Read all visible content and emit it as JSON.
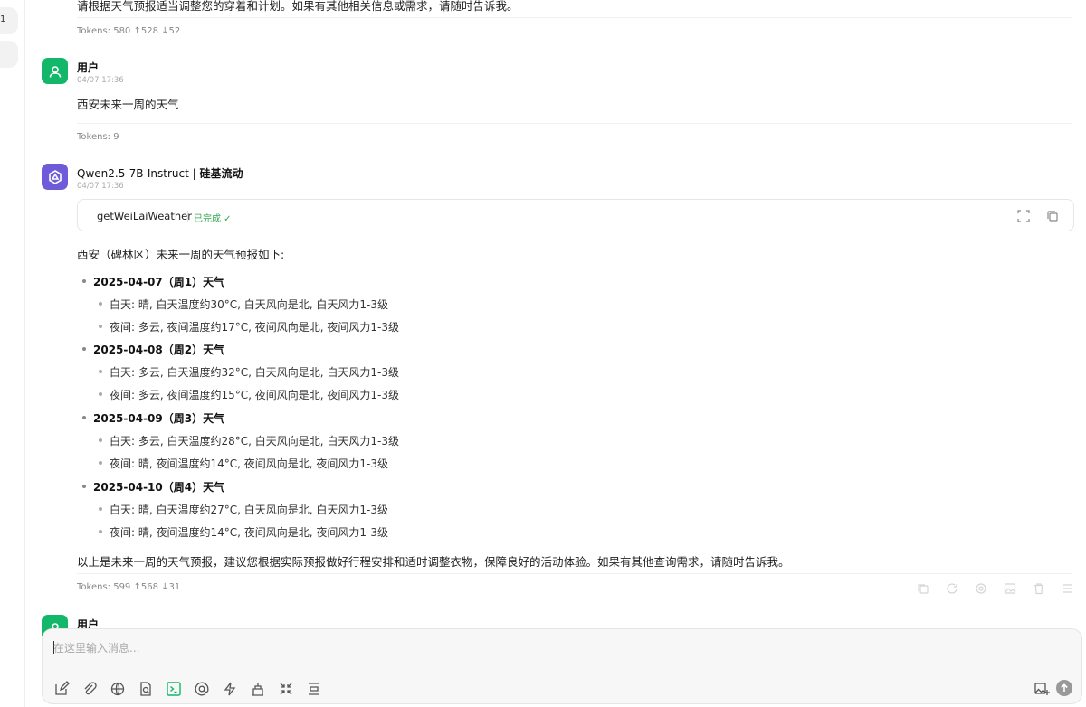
{
  "rail": {
    "item1_label": "1"
  },
  "prev_message": {
    "text_tail": "请根据天气预报适当调整您的穿着和计划。如果有其他相关信息或需求，请随时告诉我。",
    "tokens": "Tokens: 580 ↑528 ↓52"
  },
  "user_message": {
    "name": "用户",
    "time": "04/07 17:36",
    "text": "西安未来一周的天气",
    "tokens": "Tokens: 9"
  },
  "assistant_message": {
    "name_model": "Qwen2.5-7B-Instruct",
    "name_sep": " | ",
    "name_provider": "硅基流动",
    "time": "04/07 17:36",
    "tool": {
      "name": "getWeiLaiWeather",
      "status": "已完成 ✓"
    },
    "intro": "西安（碑林区）未来一周的天气预报如下:",
    "days": [
      {
        "title": "2025-04-07（周1）天气",
        "day": "白天: 晴, 白天温度约30°C, 白天风向是北, 白天风力1-3级",
        "night": "夜间: 多云, 夜间温度约17°C, 夜间风向是北, 夜间风力1-3级"
      },
      {
        "title": "2025-04-08（周2）天气",
        "day": "白天: 多云, 白天温度约32°C, 白天风向是北, 白天风力1-3级",
        "night": "夜间: 多云, 夜间温度约15°C, 夜间风向是北, 夜间风力1-3级"
      },
      {
        "title": "2025-04-09（周3）天气",
        "day": "白天: 多云, 白天温度约28°C, 白天风向是北, 白天风力1-3级",
        "night": "夜间: 晴, 夜间温度约14°C, 夜间风向是北, 夜间风力1-3级"
      },
      {
        "title": "2025-04-10（周4）天气",
        "day": "白天: 晴, 白天温度约27°C, 白天风向是北, 白天风力1-3级",
        "night": "夜间: 晴, 夜间温度约14°C, 夜间风向是北, 夜间风力1-3级"
      }
    ],
    "outro": "以上是未来一周的天气预报，建议您根据实际预报做好行程安排和适时调整衣物，保障良好的活动体验。如果有其他查询需求，请随时告诉我。",
    "tokens": "Tokens: 599 ↑568 ↓31"
  },
  "next_message": {
    "name": "用户"
  },
  "input": {
    "placeholder": "在这里输入消息..."
  },
  "colors": {
    "user_avatar": "#12b76a",
    "bot_avatar": "#6d5bd9",
    "tool_done": "#34a853"
  }
}
